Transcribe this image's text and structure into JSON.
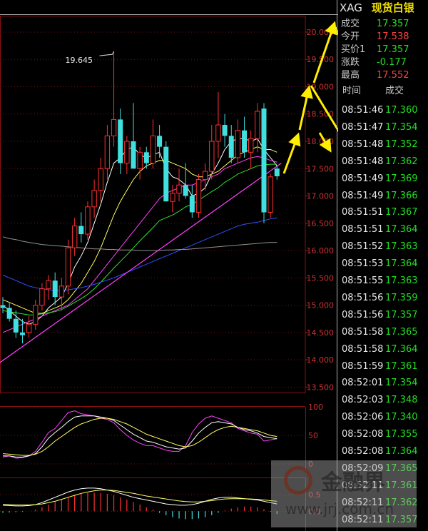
{
  "quote": {
    "symbol": "XAG",
    "name": "现货白银",
    "rows": [
      {
        "label": "成交",
        "value": "17.357",
        "color": "dn"
      },
      {
        "label": "今开",
        "value": "17.538",
        "color": "up"
      },
      {
        "label": "买价1",
        "value": "17.357",
        "color": "dn"
      },
      {
        "label": "涨跌",
        "value": "-0.177",
        "color": "dn"
      },
      {
        "label": "最高",
        "value": "17.552",
        "color": "up"
      }
    ]
  },
  "ticks": {
    "col_time": "时间",
    "col_price": "成交",
    "rows": [
      {
        "time": "08:51:46",
        "price": "17.360"
      },
      {
        "time": "08:51:47",
        "price": "17.354"
      },
      {
        "time": "08:51:48",
        "price": "17.352"
      },
      {
        "time": "08:51:48",
        "price": "17.362"
      },
      {
        "time": "08:51:49",
        "price": "17.369"
      },
      {
        "time": "08:51:49",
        "price": "17.366"
      },
      {
        "time": "08:51:51",
        "price": "17.367"
      },
      {
        "time": "08:51:51",
        "price": "17.364"
      },
      {
        "time": "08:51:52",
        "price": "17.363"
      },
      {
        "time": "08:51:53",
        "price": "17.364"
      },
      {
        "time": "08:51:55",
        "price": "17.363"
      },
      {
        "time": "08:51:56",
        "price": "17.359"
      },
      {
        "time": "08:51:56",
        "price": "17.357"
      },
      {
        "time": "08:51:58",
        "price": "17.365"
      },
      {
        "time": "08:51:58",
        "price": "17.364"
      },
      {
        "time": "08:51:59",
        "price": "17.361"
      },
      {
        "time": "08:52:01",
        "price": "17.354"
      },
      {
        "time": "08:52:03",
        "price": "17.348"
      },
      {
        "time": "08:52:06",
        "price": "17.340"
      },
      {
        "time": "08:52:08",
        "price": "17.355"
      },
      {
        "time": "08:52:08",
        "price": "17.364"
      },
      {
        "time": "08:52:09",
        "price": "17.365"
      },
      {
        "time": "08:52:11",
        "price": "17.361"
      },
      {
        "time": "08:52:11",
        "price": "17.362"
      },
      {
        "time": "08:52:11",
        "price": "17.357"
      }
    ]
  },
  "watermark": {
    "brand": "金融界",
    "url": "www.jrj.com.cn"
  },
  "chart_data": [
    {
      "type": "candlestick",
      "title": "",
      "ylim": [
        13.4,
        20.3
      ],
      "yticks": [
        "20.000",
        "19.500",
        "19.000",
        "18.500",
        "18.000",
        "17.500",
        "17.000",
        "16.500",
        "16.000",
        "15.500",
        "15.000",
        "14.500",
        "14.000",
        "13.500"
      ],
      "annotations": [
        "19.645"
      ],
      "colors": {
        "up": "#ff3030",
        "down": "#40e0e0",
        "ma5": "#ffffff",
        "ma10": "#ffff60",
        "ma20": "#ff40ff",
        "ma30": "#30e030",
        "ma60": "#3050ff",
        "ma120": "#909090",
        "trend": "#ff40ff"
      },
      "candles": [
        {
          "o": 15.0,
          "h": 15.15,
          "l": 14.85,
          "c": 14.95
        },
        {
          "o": 14.95,
          "h": 15.05,
          "l": 14.7,
          "c": 14.75
        },
        {
          "o": 14.75,
          "h": 14.9,
          "l": 14.4,
          "c": 14.5
        },
        {
          "o": 14.5,
          "h": 14.75,
          "l": 14.3,
          "c": 14.45
        },
        {
          "o": 14.5,
          "h": 14.8,
          "l": 14.4,
          "c": 14.65
        },
        {
          "o": 14.65,
          "h": 15.1,
          "l": 14.55,
          "c": 15.0
        },
        {
          "o": 15.0,
          "h": 15.4,
          "l": 14.9,
          "c": 15.3
        },
        {
          "o": 15.3,
          "h": 15.55,
          "l": 15.1,
          "c": 15.45
        },
        {
          "o": 15.45,
          "h": 15.6,
          "l": 15.0,
          "c": 15.15
        },
        {
          "o": 15.15,
          "h": 15.5,
          "l": 14.9,
          "c": 15.35
        },
        {
          "o": 15.35,
          "h": 16.2,
          "l": 15.2,
          "c": 16.05
        },
        {
          "o": 16.05,
          "h": 16.6,
          "l": 15.9,
          "c": 16.45
        },
        {
          "o": 16.45,
          "h": 16.7,
          "l": 16.15,
          "c": 16.3
        },
        {
          "o": 16.3,
          "h": 16.9,
          "l": 16.2,
          "c": 16.8
        },
        {
          "o": 16.8,
          "h": 17.3,
          "l": 16.6,
          "c": 17.1
        },
        {
          "o": 17.1,
          "h": 17.7,
          "l": 16.9,
          "c": 17.5
        },
        {
          "o": 17.5,
          "h": 18.3,
          "l": 17.3,
          "c": 18.1
        },
        {
          "o": 18.1,
          "h": 19.645,
          "l": 17.9,
          "c": 18.4
        },
        {
          "o": 18.4,
          "h": 18.6,
          "l": 17.4,
          "c": 17.6
        },
        {
          "o": 17.6,
          "h": 18.1,
          "l": 17.4,
          "c": 18.0
        },
        {
          "o": 18.0,
          "h": 18.7,
          "l": 17.5,
          "c": 17.5
        },
        {
          "o": 17.5,
          "h": 17.9,
          "l": 17.3,
          "c": 17.8
        },
        {
          "o": 17.8,
          "h": 17.9,
          "l": 17.5,
          "c": 17.6
        },
        {
          "o": 17.6,
          "h": 18.4,
          "l": 17.5,
          "c": 18.1
        },
        {
          "o": 18.1,
          "h": 18.3,
          "l": 17.7,
          "c": 17.9
        },
        {
          "o": 17.9,
          "h": 18.0,
          "l": 16.9,
          "c": 16.9
        },
        {
          "o": 16.9,
          "h": 17.2,
          "l": 16.7,
          "c": 17.05
        },
        {
          "o": 17.05,
          "h": 17.5,
          "l": 16.9,
          "c": 17.2
        },
        {
          "o": 17.2,
          "h": 17.6,
          "l": 16.95,
          "c": 17.0
        },
        {
          "o": 17.0,
          "h": 17.2,
          "l": 16.6,
          "c": 16.7
        },
        {
          "o": 16.7,
          "h": 17.4,
          "l": 16.6,
          "c": 17.3
        },
        {
          "o": 17.3,
          "h": 17.6,
          "l": 17.1,
          "c": 17.45
        },
        {
          "o": 17.45,
          "h": 18.3,
          "l": 17.3,
          "c": 18.0
        },
        {
          "o": 18.0,
          "h": 18.9,
          "l": 17.7,
          "c": 18.3
        },
        {
          "o": 18.3,
          "h": 18.5,
          "l": 17.9,
          "c": 18.1
        },
        {
          "o": 18.1,
          "h": 18.3,
          "l": 17.6,
          "c": 17.7
        },
        {
          "o": 17.7,
          "h": 18.4,
          "l": 17.6,
          "c": 18.2
        },
        {
          "o": 18.2,
          "h": 18.45,
          "l": 17.7,
          "c": 17.8
        },
        {
          "o": 17.8,
          "h": 18.2,
          "l": 17.5,
          "c": 18.05
        },
        {
          "o": 18.05,
          "h": 18.7,
          "l": 17.8,
          "c": 18.55
        },
        {
          "o": 18.6,
          "h": 18.7,
          "l": 16.5,
          "c": 16.7
        },
        {
          "o": 16.7,
          "h": 17.4,
          "l": 16.6,
          "c": 17.35
        },
        {
          "o": 17.5,
          "h": 17.55,
          "l": 17.3,
          "c": 17.36
        }
      ],
      "ma": {
        "ma5": [
          15.0,
          14.9,
          14.8,
          14.7,
          14.65,
          14.7,
          14.8,
          14.95,
          15.05,
          15.15,
          15.4,
          15.7,
          15.9,
          16.15,
          16.5,
          16.85,
          17.25,
          17.6,
          17.7,
          17.85,
          17.9,
          17.75,
          17.7,
          17.75,
          17.8,
          17.5,
          17.35,
          17.3,
          17.2,
          17.0,
          17.05,
          17.15,
          17.4,
          17.6,
          17.85,
          18.0,
          18.05,
          18.05,
          18.0,
          18.05,
          17.85,
          17.7,
          17.55
        ],
        "ma10": [
          15.1,
          15.05,
          15.0,
          14.95,
          14.9,
          14.85,
          14.85,
          14.9,
          14.95,
          15.0,
          15.1,
          15.25,
          15.4,
          15.6,
          15.8,
          16.05,
          16.35,
          16.65,
          16.9,
          17.1,
          17.3,
          17.45,
          17.55,
          17.6,
          17.65,
          17.65,
          17.6,
          17.55,
          17.5,
          17.4,
          17.35,
          17.35,
          17.4,
          17.45,
          17.55,
          17.65,
          17.75,
          17.8,
          17.85,
          17.9,
          17.85,
          17.85,
          17.8
        ],
        "ma20": [
          14.5,
          14.55,
          14.6,
          14.65,
          14.7,
          14.75,
          14.8,
          14.85,
          14.9,
          14.95,
          15.0,
          15.1,
          15.2,
          15.3,
          15.45,
          15.6,
          15.75,
          15.9,
          16.05,
          16.2,
          16.35,
          16.5,
          16.65,
          16.8,
          16.95,
          17.05,
          17.1,
          17.15,
          17.2,
          17.2,
          17.25,
          17.3,
          17.35,
          17.4,
          17.5,
          17.55,
          17.6,
          17.65,
          17.7,
          17.72,
          17.7,
          17.65,
          17.62
        ],
        "ma30": [
          14.9,
          14.88,
          14.86,
          14.84,
          14.82,
          14.82,
          14.84,
          14.86,
          14.88,
          14.92,
          14.98,
          15.05,
          15.12,
          15.2,
          15.3,
          15.42,
          15.55,
          15.68,
          15.8,
          15.92,
          16.05,
          16.18,
          16.3,
          16.42,
          16.55,
          16.6,
          16.65,
          16.72,
          16.8,
          16.85,
          16.92,
          17.0,
          17.08,
          17.15,
          17.25,
          17.32,
          17.4,
          17.45,
          17.5,
          17.55,
          17.57,
          17.58,
          17.58
        ],
        "ma60": [
          15.55,
          15.5,
          15.45,
          15.4,
          15.35,
          15.32,
          15.3,
          15.28,
          15.27,
          15.27,
          15.28,
          15.3,
          15.32,
          15.35,
          15.38,
          15.42,
          15.46,
          15.5,
          15.55,
          15.6,
          15.65,
          15.7,
          15.75,
          15.8,
          15.85,
          15.9,
          15.95,
          16.0,
          16.05,
          16.1,
          16.15,
          16.2,
          16.25,
          16.3,
          16.35,
          16.4,
          16.45,
          16.48,
          16.5,
          16.52,
          16.55,
          16.58,
          16.6
        ],
        "ma120": [
          16.25,
          16.22,
          16.2,
          16.17,
          16.15,
          16.13,
          16.11,
          16.1,
          16.09,
          16.08,
          16.07,
          16.06,
          16.05,
          16.04,
          16.03,
          16.03,
          16.02,
          16.02,
          16.01,
          16.01,
          16.01,
          16.0,
          16.0,
          16.0,
          16.0,
          16.01,
          16.01,
          16.02,
          16.02,
          16.03,
          16.04,
          16.05,
          16.06,
          16.07,
          16.08,
          16.09,
          16.1,
          16.11,
          16.12,
          16.13,
          16.14,
          16.15,
          16.15
        ]
      },
      "trendline": [
        [
          0,
          13.95
        ],
        [
          42,
          17.6
        ]
      ]
    },
    {
      "type": "line",
      "title": "",
      "ylim": [
        0,
        100
      ],
      "yticks": [
        "100",
        "50",
        "0"
      ],
      "series": [
        {
          "color": "#ff40ff",
          "values": [
            12,
            14,
            10,
            11,
            14,
            22,
            38,
            55,
            62,
            76,
            90,
            93,
            88,
            86,
            84,
            80,
            78,
            72,
            60,
            50,
            42,
            36,
            32,
            32,
            28,
            24,
            22,
            22,
            32,
            55,
            70,
            80,
            84,
            80,
            76,
            72,
            62,
            58,
            54,
            52,
            40,
            42,
            44
          ]
        },
        {
          "color": "#ffffff",
          "values": [
            14,
            14,
            12,
            12,
            14,
            18,
            30,
            45,
            55,
            64,
            74,
            82,
            84,
            84,
            84,
            82,
            80,
            76,
            68,
            60,
            52,
            46,
            40,
            38,
            34,
            30,
            28,
            26,
            28,
            40,
            54,
            64,
            72,
            74,
            72,
            70,
            64,
            60,
            58,
            54,
            48,
            46,
            44
          ]
        },
        {
          "color": "#ffff60",
          "values": [
            18,
            17,
            16,
            15,
            15,
            17,
            22,
            30,
            40,
            48,
            56,
            64,
            70,
            74,
            78,
            80,
            80,
            78,
            74,
            70,
            64,
            58,
            52,
            48,
            44,
            40,
            36,
            32,
            30,
            32,
            38,
            46,
            54,
            60,
            64,
            66,
            64,
            62,
            60,
            58,
            54,
            50,
            48
          ]
        }
      ]
    },
    {
      "type": "bar",
      "title": "",
      "ylim": [
        -0.6,
        1.0
      ],
      "yticks": [
        "0.5",
        "0.0"
      ],
      "values": [
        -0.05,
        -0.04,
        -0.03,
        -0.02,
        0.0,
        0.05,
        0.12,
        0.2,
        0.28,
        0.35,
        0.42,
        0.48,
        0.52,
        0.55,
        0.56,
        0.55,
        0.52,
        0.48,
        0.42,
        0.35,
        0.28,
        0.2,
        0.12,
        0.05,
        -0.05,
        -0.12,
        -0.18,
        -0.22,
        -0.24,
        -0.24,
        -0.22,
        -0.18,
        -0.12,
        -0.05,
        0.02,
        0.08,
        0.12,
        0.14,
        0.14,
        0.12,
        0.06,
        -0.02,
        -0.08
      ],
      "series": [
        {
          "color": "#ffffff",
          "values": [
            0.18,
            0.17,
            0.16,
            0.16,
            0.17,
            0.2,
            0.26,
            0.34,
            0.42,
            0.5,
            0.58,
            0.64,
            0.68,
            0.7,
            0.7,
            0.68,
            0.64,
            0.6,
            0.54,
            0.48,
            0.42,
            0.38,
            0.34,
            0.3,
            0.26,
            0.22,
            0.2,
            0.18,
            0.18,
            0.2,
            0.24,
            0.3,
            0.36,
            0.4,
            0.42,
            0.42,
            0.4,
            0.38,
            0.36,
            0.34,
            0.3,
            0.26,
            0.22
          ]
        },
        {
          "color": "#ffff60",
          "values": [
            0.2,
            0.2,
            0.19,
            0.19,
            0.19,
            0.2,
            0.22,
            0.26,
            0.3,
            0.36,
            0.42,
            0.48,
            0.54,
            0.58,
            0.62,
            0.64,
            0.64,
            0.63,
            0.6,
            0.57,
            0.54,
            0.5,
            0.46,
            0.43,
            0.4,
            0.37,
            0.34,
            0.31,
            0.29,
            0.28,
            0.28,
            0.3,
            0.32,
            0.35,
            0.37,
            0.38,
            0.38,
            0.38,
            0.37,
            0.36,
            0.34,
            0.32,
            0.3
          ]
        }
      ]
    }
  ]
}
